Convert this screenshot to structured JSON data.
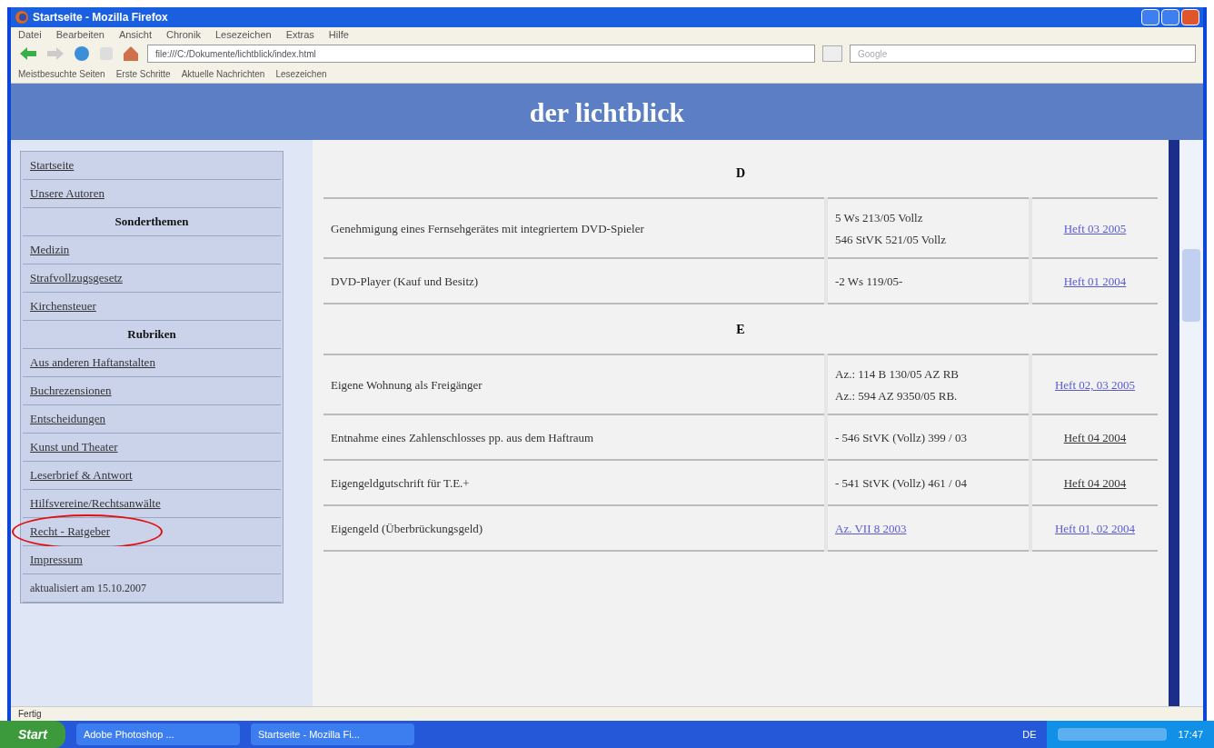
{
  "window": {
    "title": "Startseite - Mozilla Firefox"
  },
  "menu": [
    "Datei",
    "Bearbeiten",
    "Ansicht",
    "Chronik",
    "Lesezeichen",
    "Extras",
    "Hilfe"
  ],
  "address": {
    "value": "file:///C:/Dokumente/lichtblick/index.html"
  },
  "search": {
    "placeholder": "Google"
  },
  "bookmarks": [
    "Meistbesuchte Seiten",
    "Erste Schritte",
    "Aktuelle Nachrichten",
    "Lesezeichen"
  ],
  "site": {
    "title": "der lichtblick"
  },
  "sidebar": [
    {
      "kind": "link",
      "label": "Startseite"
    },
    {
      "kind": "link",
      "label": "Unsere Autoren"
    },
    {
      "kind": "header",
      "label": "Sonderthemen"
    },
    {
      "kind": "link",
      "label": "Medizin"
    },
    {
      "kind": "link",
      "label": "Strafvollzugsgesetz"
    },
    {
      "kind": "link",
      "label": "Kirchensteuer"
    },
    {
      "kind": "header",
      "label": "Rubriken"
    },
    {
      "kind": "link",
      "label": "Aus anderen Haftanstalten"
    },
    {
      "kind": "link",
      "label": "Buchrezensionen"
    },
    {
      "kind": "link",
      "label": "Entscheidungen"
    },
    {
      "kind": "link",
      "label": "Kunst und Theater"
    },
    {
      "kind": "link",
      "label": "Leserbrief & Antwort"
    },
    {
      "kind": "link",
      "label": "Hilfsvereine/Rechtsanwälte"
    },
    {
      "kind": "link",
      "label": "Recht - Ratgeber",
      "circled": true
    },
    {
      "kind": "link",
      "label": "Impressum"
    },
    {
      "kind": "note",
      "label": "aktualisiert am 15.10.2007"
    }
  ],
  "table": {
    "rows": [
      {
        "kind": "letter",
        "letter": "D"
      },
      {
        "kind": "entry",
        "topic": "Genehmigung eines Fernsehgerätes mit integriertem DVD-Spieler",
        "reference": {
          "text": "5 Ws 213/05 Vollz\n546 StVK 521/05 Vollz",
          "link": false
        },
        "issue": {
          "text": "Heft 03 2005",
          "visited": false
        }
      },
      {
        "kind": "entry",
        "topic": "DVD-Player (Kauf und Besitz)",
        "reference": {
          "text": "-2 Ws 119/05-",
          "link": false
        },
        "issue": {
          "text": "Heft 01 2004",
          "visited": false
        }
      },
      {
        "kind": "letter",
        "letter": "E"
      },
      {
        "kind": "entry",
        "topic": "Eigene Wohnung als Freigänger",
        "reference": {
          "text": "Az.: 114 B 130/05 AZ RB\nAz.: 594 AZ 9350/05 RB.",
          "link": false
        },
        "issue": {
          "text": "Heft 02, 03 2005",
          "visited": false
        }
      },
      {
        "kind": "entry",
        "topic": "Entnahme eines Zahlenschlosses pp. aus dem Haftraum",
        "reference": {
          "text": "- 546 StVK (Vollz) 399 / 03",
          "link": false
        },
        "issue": {
          "text": "Heft 04 2004",
          "visited": true
        }
      },
      {
        "kind": "entry",
        "topic": "Eigengeldgutschrift für T.E.+",
        "reference": {
          "text": "- 541 StVK (Vollz) 461 / 04",
          "link": false
        },
        "issue": {
          "text": "Heft 04 2004",
          "visited": true
        }
      },
      {
        "kind": "entry",
        "topic": "Eigengeld (Überbrückungsgeld)",
        "reference": {
          "text": "Az. VII 8 2003",
          "link": true
        },
        "issue": {
          "text": "Heft 01, 02 2004",
          "visited": false
        }
      }
    ]
  },
  "status_bar": {
    "text": "Fertig"
  },
  "taskbar": {
    "start": "Start",
    "tasks": [
      "Adobe Photoshop ...",
      "Startseite - Mozilla Fi..."
    ],
    "language": "DE",
    "clock": "17:47"
  }
}
